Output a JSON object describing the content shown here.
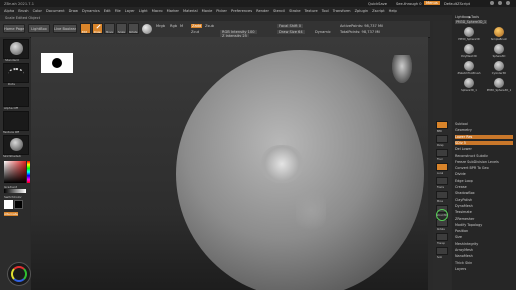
{
  "window": {
    "title": "ZBrush 2021.7.1"
  },
  "top_right": {
    "quicksave": "QuickSave",
    "see_through": "See-through 0",
    "menus": "Menus",
    "default_script": "DefaultZScript"
  },
  "menu": {
    "items": [
      "Alpha",
      "Brush",
      "Color",
      "Document",
      "Draw",
      "Dynamics",
      "Edit",
      "File",
      "Layer",
      "Light",
      "Macro",
      "Marker",
      "Material",
      "Movie",
      "Picker",
      "Preferences",
      "Render",
      "Stencil",
      "Stroke",
      "Texture",
      "Tool",
      "Transform",
      "Zplugin",
      "Zscript",
      "Help"
    ]
  },
  "status_line": "Scale Edited Object",
  "toolbar": {
    "home_page": "Home Page",
    "lightbox": "LightBox",
    "live_boolean": "Live Boolean",
    "edit": "Edit",
    "draw": "Draw",
    "move": "Move",
    "scale": "Scale",
    "rotate": "Rotate",
    "mrgb": "Mrgb",
    "rgb": "Rgb",
    "m": "M",
    "zadd": "Zadd",
    "zsub": "Zsub",
    "zcut": "Zcut",
    "focal_shift": "Focal Shift 0",
    "draw_size": "Draw Size 64",
    "dynamic": "Dynamic",
    "rgb_intensity": "RGB Intensity 100",
    "z_intensity": "Z Intensity 25",
    "active_points": "ActivePoints: 98,737 Mil",
    "total_points": "TotalPoints: 98,737 Mil"
  },
  "left_shelf": {
    "brush1": "Standard",
    "brush2": "Dots",
    "alpha": "Alpha Off",
    "texture": "Texture Off",
    "material": "SkinShade4",
    "gradient": "Gradient",
    "switch_color": "SwitchColor",
    "alternate": "Alternate"
  },
  "tool_panel": {
    "lightbox_tools": "Lightbox▶Tools",
    "current_tool": "PM3D_Sphere3D_1",
    "subtools": [
      "PM3D_Sphere3D",
      "SimpleBrush",
      "PolyMesh3D",
      "Sphere3D",
      "ZSketchToolBrush",
      "Cylinder3D",
      "Sphere3D_1",
      "PM3D_Sphere3D_1"
    ],
    "items": [
      {
        "label": "Subtool",
        "hl": false
      },
      {
        "label": "Geometry",
        "hl": false
      },
      {
        "label": "Lower Res",
        "hl": true
      },
      {
        "label": "SDiv 5",
        "hl": true
      },
      {
        "label": "Del Lower",
        "hl": false
      },
      {
        "label": "Reconstruct Subdiv",
        "hl": false
      },
      {
        "label": "Freeze SubDivision Levels",
        "hl": false
      },
      {
        "label": "Convert BPR To Geo",
        "hl": false
      },
      {
        "label": "Divide",
        "hl": false
      },
      {
        "label": "Edge Loop",
        "hl": false
      },
      {
        "label": "Crease",
        "hl": false
      },
      {
        "label": "ShadowBox",
        "hl": false
      },
      {
        "label": "ClayPolish",
        "hl": false
      },
      {
        "label": "DynaMesh",
        "hl": false
      },
      {
        "label": "Tessimate",
        "hl": false
      },
      {
        "label": "ZRemesher",
        "hl": false
      },
      {
        "label": "Modify Topology",
        "hl": false
      },
      {
        "label": "Position",
        "hl": false
      },
      {
        "label": "Size",
        "hl": false
      },
      {
        "label": "MeshIntegrity",
        "hl": false
      },
      {
        "label": "ArrayMesh",
        "hl": false
      },
      {
        "label": "NanoMesh",
        "hl": false
      },
      {
        "label": "Thick Skin",
        "hl": false
      },
      {
        "label": "Layers",
        "hl": false
      }
    ]
  },
  "right_shelf": {
    "labels": [
      "BPR",
      "Persp",
      "Floor",
      "Local",
      "Frame",
      "Move",
      "Zoom3D",
      "Rotate",
      "Transp",
      "Solo"
    ]
  },
  "colors": {
    "accent": "#d9842a",
    "canvas_bg": "#303030",
    "highlight": "#c9772a"
  }
}
